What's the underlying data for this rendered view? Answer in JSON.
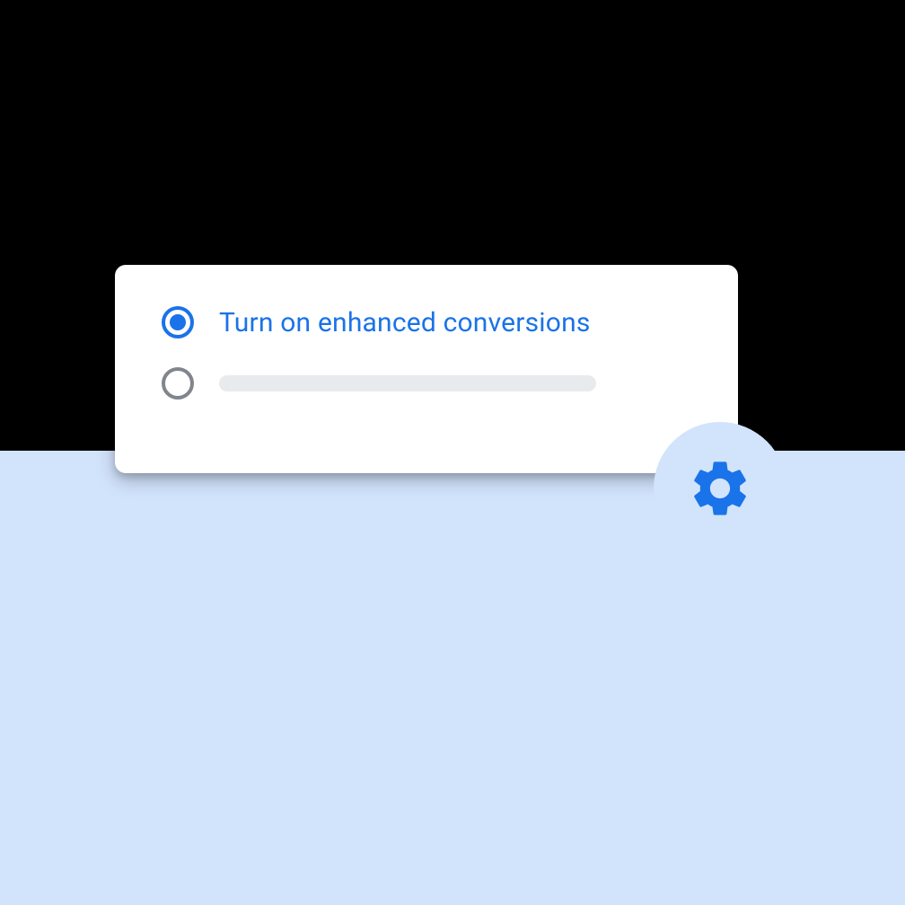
{
  "card": {
    "options": [
      {
        "label": "Turn on enhanced conversions",
        "selected": true
      },
      {
        "label": "",
        "selected": false
      }
    ]
  },
  "colors": {
    "primary": "#1a73e8",
    "background_light": "#d2e3fc",
    "placeholder": "#e8eaed",
    "radio_unselected": "#80868b"
  },
  "icons": {
    "gear": "gear-icon"
  }
}
